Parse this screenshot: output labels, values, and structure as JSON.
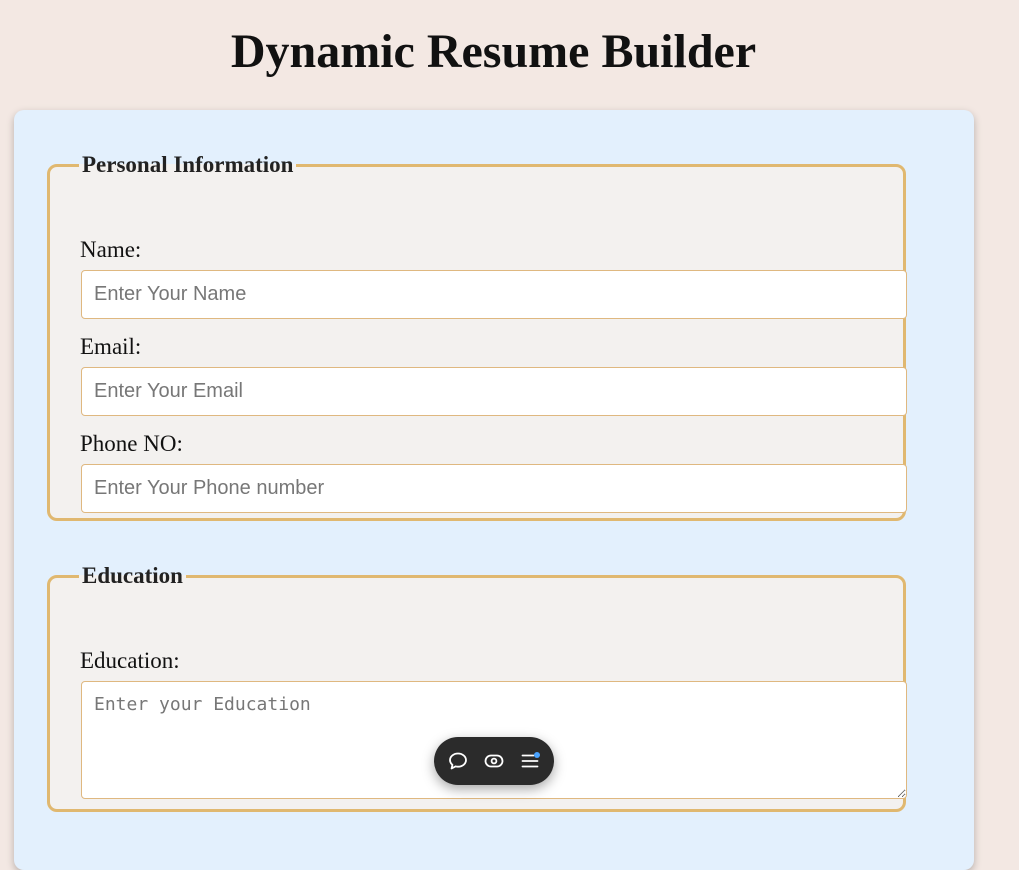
{
  "header": {
    "title": "Dynamic Resume Builder"
  },
  "personal": {
    "legend": "Personal Information",
    "name_label": "Name:",
    "name_placeholder": "Enter Your Name",
    "email_label": "Email:",
    "email_placeholder": "Enter Your Email",
    "phone_label": "Phone NO:",
    "phone_placeholder": "Enter Your Phone number"
  },
  "education": {
    "legend": "Education",
    "label": "Education:",
    "placeholder": "Enter your Education"
  },
  "toolbar": {
    "items": [
      {
        "icon": "comment-icon"
      },
      {
        "icon": "eye-icon"
      },
      {
        "icon": "menu-icon",
        "badge_color": "#4aa3ff"
      }
    ]
  },
  "colors": {
    "page_bg": "#f3e8e3",
    "card_bg": "#e3f0fd",
    "fieldset_border": "#e0b870",
    "toolbar_bg": "#2b2b2b"
  }
}
